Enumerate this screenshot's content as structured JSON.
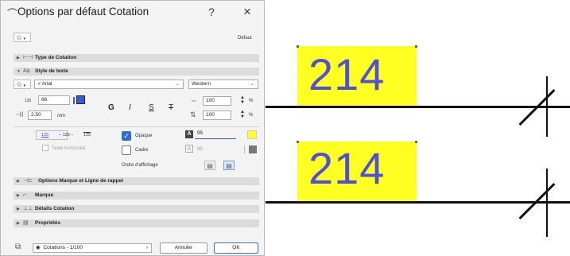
{
  "dialog": {
    "title": "Options par défaut Cotation",
    "help_label": "?",
    "close_label": "×",
    "favorite_default": "Défaut"
  },
  "sections": {
    "type_cotation": "Type de Cotation",
    "style_texte": "Style de texte",
    "options_marque": "Options Marque et Ligne de rappel",
    "marque": "Marque",
    "details": "Détails Cotation",
    "proprietes": "Propriétés"
  },
  "text_style": {
    "font": "Arial",
    "script": "Western",
    "height_label": "125",
    "height_value": "66",
    "size_value": "2.50",
    "size_unit": "mm",
    "bold": "G",
    "italic": "I",
    "underline": "S",
    "strike": "T",
    "width_value": "100",
    "spacing_value": "100",
    "percent": "%",
    "sample_a": "125",
    "sample_b": "125",
    "sample_c": "125",
    "text_horizontal": "Texte horizontal",
    "opaque": "Opaque",
    "frame": "Cadre",
    "display_order": "Ordre d'affichage",
    "bg_pen_value": "95",
    "frame_pen_value": "85"
  },
  "footer": {
    "layer": "Cotations - 1/100",
    "cancel": "Annuler",
    "ok": "OK"
  },
  "drawing": {
    "dim_text_1": "214",
    "dim_text_2": "214"
  },
  "colors": {
    "text_color": "#3a5bd8",
    "highlight": "#ffff22",
    "dim_text": "#5050d8",
    "opaque_check": "#2a6fd8"
  }
}
